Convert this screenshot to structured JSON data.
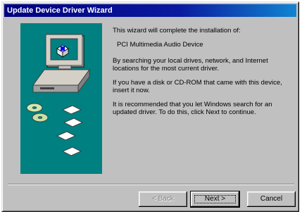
{
  "window": {
    "title": "Update Device Driver Wizard"
  },
  "body": {
    "intro": "This wizard will complete the installation of:",
    "device_name": "PCI Multimedia Audio Device",
    "search_text": "By searching your local drives, network, and Internet locations for the most current driver.",
    "disk_text": "If you have a disk or CD-ROM that came with this device, insert it now.",
    "recommend_text": "It is recommended that you let Windows search for an updated driver. To do this, click Next to continue."
  },
  "buttons": {
    "back_label": "< Back",
    "next_label": "Next >",
    "cancel_label": "Cancel"
  },
  "illustration": {
    "icon": "computer-with-disks-icon",
    "background_color": "#008080"
  }
}
